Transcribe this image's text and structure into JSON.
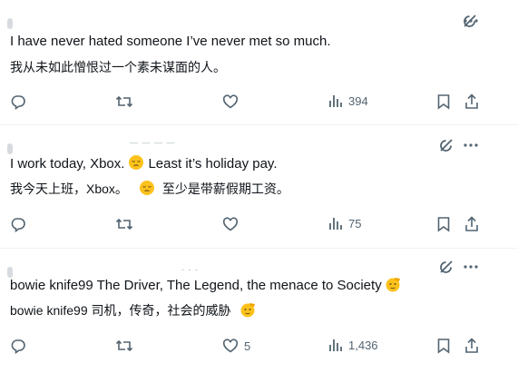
{
  "posts": [
    {
      "text_en": "I have never hated someone I’ve never met so much.",
      "text_zh": "我从未如此憎恨过一个素未谋面的人。",
      "reply_count": "",
      "repost_count": "",
      "like_count": "",
      "views": "394"
    },
    {
      "text_en": "I work today, Xbox.",
      "text_en_after": "Least it’s holiday pay.",
      "text_zh": "我今天上班，Xbox。",
      "text_zh_after": "至少是带薪假期工资。",
      "reply_count": "",
      "repost_count": "",
      "like_count": "",
      "views": "75"
    },
    {
      "text_en": "bowie knife99 The Driver, The Legend, the menace  to Society",
      "text_zh": "bowie knife99 司机，传奇，社会的威胁",
      "reply_count": "",
      "repost_count": "",
      "like_count": "5",
      "views": "1,436"
    }
  ],
  "icons": {
    "grok": "grok-icon",
    "more": "more-icon",
    "reply": "reply-icon",
    "repost": "repost-icon",
    "like": "like-icon",
    "views": "views-icon",
    "bookmark": "bookmark-icon",
    "share": "share-icon",
    "sad_emoji": "pensive-face-emoji",
    "salute_emoji": "saluting-face-emoji"
  },
  "colors": {
    "icon": "#536471",
    "text": "#0f1419",
    "emoji": "#fcc21b"
  }
}
